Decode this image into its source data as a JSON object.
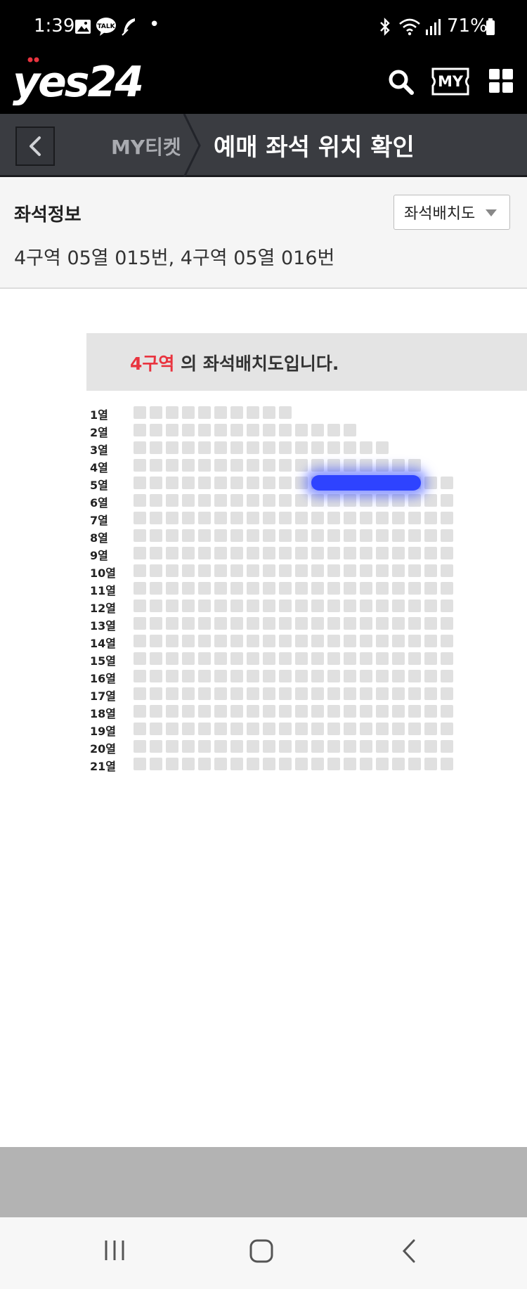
{
  "status_bar": {
    "time": "1:39",
    "battery": "71%",
    "dot": "•"
  },
  "header": {
    "logo": "yes24",
    "my_label": "MY"
  },
  "title_bar": {
    "breadcrumb_parent": "MY티켓",
    "title": "예매 좌석 위치 확인"
  },
  "seat_info": {
    "title": "좌석정보",
    "detail": "4구역 05열 015번, 4구역 05열 016번",
    "dropdown_label": "좌석배치도"
  },
  "seatmap": {
    "banner_zone": "4구역",
    "banner_suffix": " 의 좌석배치도입니다.",
    "rows": [
      {
        "label": "1열",
        "seats": 10
      },
      {
        "label": "2열",
        "seats": 14
      },
      {
        "label": "3열",
        "seats": 16
      },
      {
        "label": "4열",
        "seats": 18
      },
      {
        "label": "5열",
        "seats": 20
      },
      {
        "label": "6열",
        "seats": 20
      },
      {
        "label": "7열",
        "seats": 20
      },
      {
        "label": "8열",
        "seats": 20
      },
      {
        "label": "9열",
        "seats": 20
      },
      {
        "label": "10열",
        "seats": 20
      },
      {
        "label": "11열",
        "seats": 20
      },
      {
        "label": "12열",
        "seats": 20
      },
      {
        "label": "13열",
        "seats": 20
      },
      {
        "label": "14열",
        "seats": 20
      },
      {
        "label": "15열",
        "seats": 20
      },
      {
        "label": "16열",
        "seats": 20
      },
      {
        "label": "17열",
        "seats": 20
      },
      {
        "label": "18열",
        "seats": 20
      },
      {
        "label": "19열",
        "seats": 20
      },
      {
        "label": "20열",
        "seats": 20
      },
      {
        "label": "21열",
        "seats": 20
      }
    ],
    "selected_row": 5,
    "selected_seat_from": 12,
    "selected_seat_to": 18
  },
  "colors": {
    "accent_red": "#e9343f",
    "highlight_blue": "#2e43ff",
    "seat_gray": "#e0e0e0"
  },
  "icons": [
    "gallery-icon",
    "talk-icon",
    "feather-icon",
    "bluetooth-icon",
    "wifi-icon",
    "signal-icon",
    "battery-icon",
    "search-icon",
    "my-ticket-icon",
    "grid-menu-icon",
    "back-chevron-icon",
    "recent-apps-icon",
    "home-icon",
    "nav-back-icon"
  ]
}
